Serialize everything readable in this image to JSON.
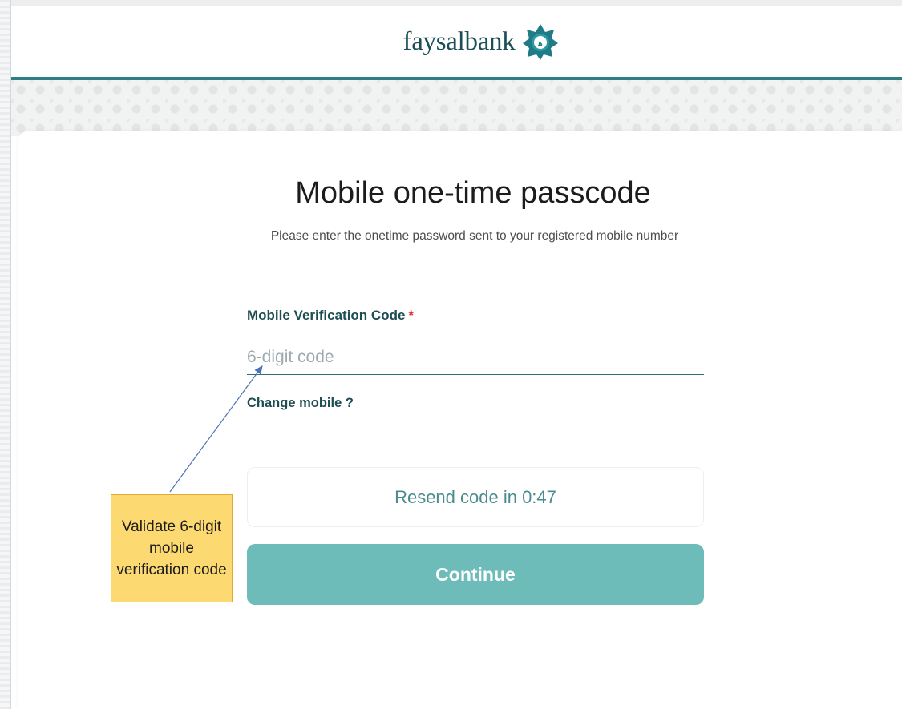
{
  "header": {
    "logo_text": "faysalbank",
    "logo_icon": "faysal-star-logo-icon",
    "accent_color": "#2e7f84"
  },
  "form": {
    "title": "Mobile one-time passcode",
    "subtitle": "Please enter the onetime password sent to your registered mobile number",
    "field_label": "Mobile Verification Code",
    "required_mark": "*",
    "code_placeholder": "6-digit code",
    "code_value": "",
    "change_mobile_link": "Change mobile ?",
    "resend_text": "Resend code in 0:47",
    "continue_label": "Continue",
    "button_color": "#6dbcba"
  },
  "annotation": {
    "text": "Validate 6-digit mobile verification code"
  }
}
